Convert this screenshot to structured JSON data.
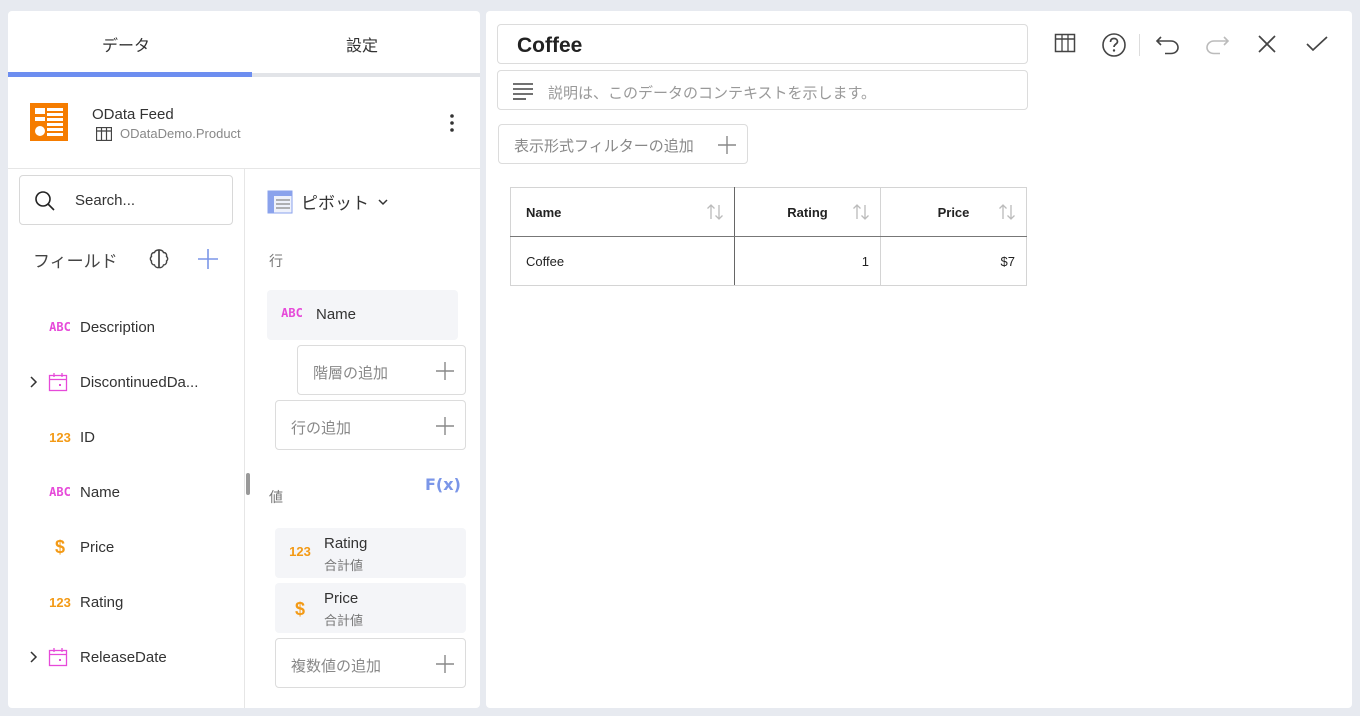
{
  "tabs": {
    "data": "データ",
    "settings": "設定"
  },
  "source": {
    "title": "OData Feed",
    "subtitle": "ODataDemo.Product"
  },
  "search": {
    "placeholder": "Search..."
  },
  "fields": {
    "heading": "フィールド",
    "items": [
      {
        "type": "ABC",
        "name": "Description",
        "expandable": false
      },
      {
        "type": "date",
        "name": "DiscontinuedDa...",
        "expandable": true
      },
      {
        "type": "123",
        "name": "ID",
        "expandable": false
      },
      {
        "type": "ABC",
        "name": "Name",
        "expandable": false
      },
      {
        "type": "$",
        "name": "Price",
        "expandable": false
      },
      {
        "type": "123",
        "name": "Rating",
        "expandable": false
      },
      {
        "type": "date",
        "name": "ReleaseDate",
        "expandable": true
      }
    ]
  },
  "pivot": {
    "label": "ピボット",
    "rows_label": "行",
    "row_chip": {
      "type": "ABC",
      "name": "Name"
    },
    "add_hierarchy": "階層の追加",
    "add_row": "行の追加",
    "values_label": "値",
    "fx": "F(x)",
    "values": [
      {
        "type": "123",
        "name": "Rating",
        "agg": "合計値"
      },
      {
        "type": "$",
        "name": "Price",
        "agg": "合計値"
      }
    ],
    "add_values": "複数値の追加"
  },
  "editor": {
    "title": "Coffee",
    "description_placeholder": "説明は、このデータのコンテキストを示します。",
    "add_filter": "表示形式フィルターの追加"
  },
  "toolbar": [
    "grid-icon",
    "help-icon",
    "undo-icon",
    "redo-icon",
    "close-icon",
    "check-icon"
  ],
  "grid": {
    "columns": [
      "Name",
      "Rating",
      "Price"
    ],
    "rows": [
      [
        "Coffee",
        "1",
        "$7"
      ]
    ]
  },
  "colors": {
    "accent": "#6d8ef0",
    "string_type": "#e64ad9",
    "number_type": "#f39a16",
    "source_icon": "#f57c00"
  }
}
